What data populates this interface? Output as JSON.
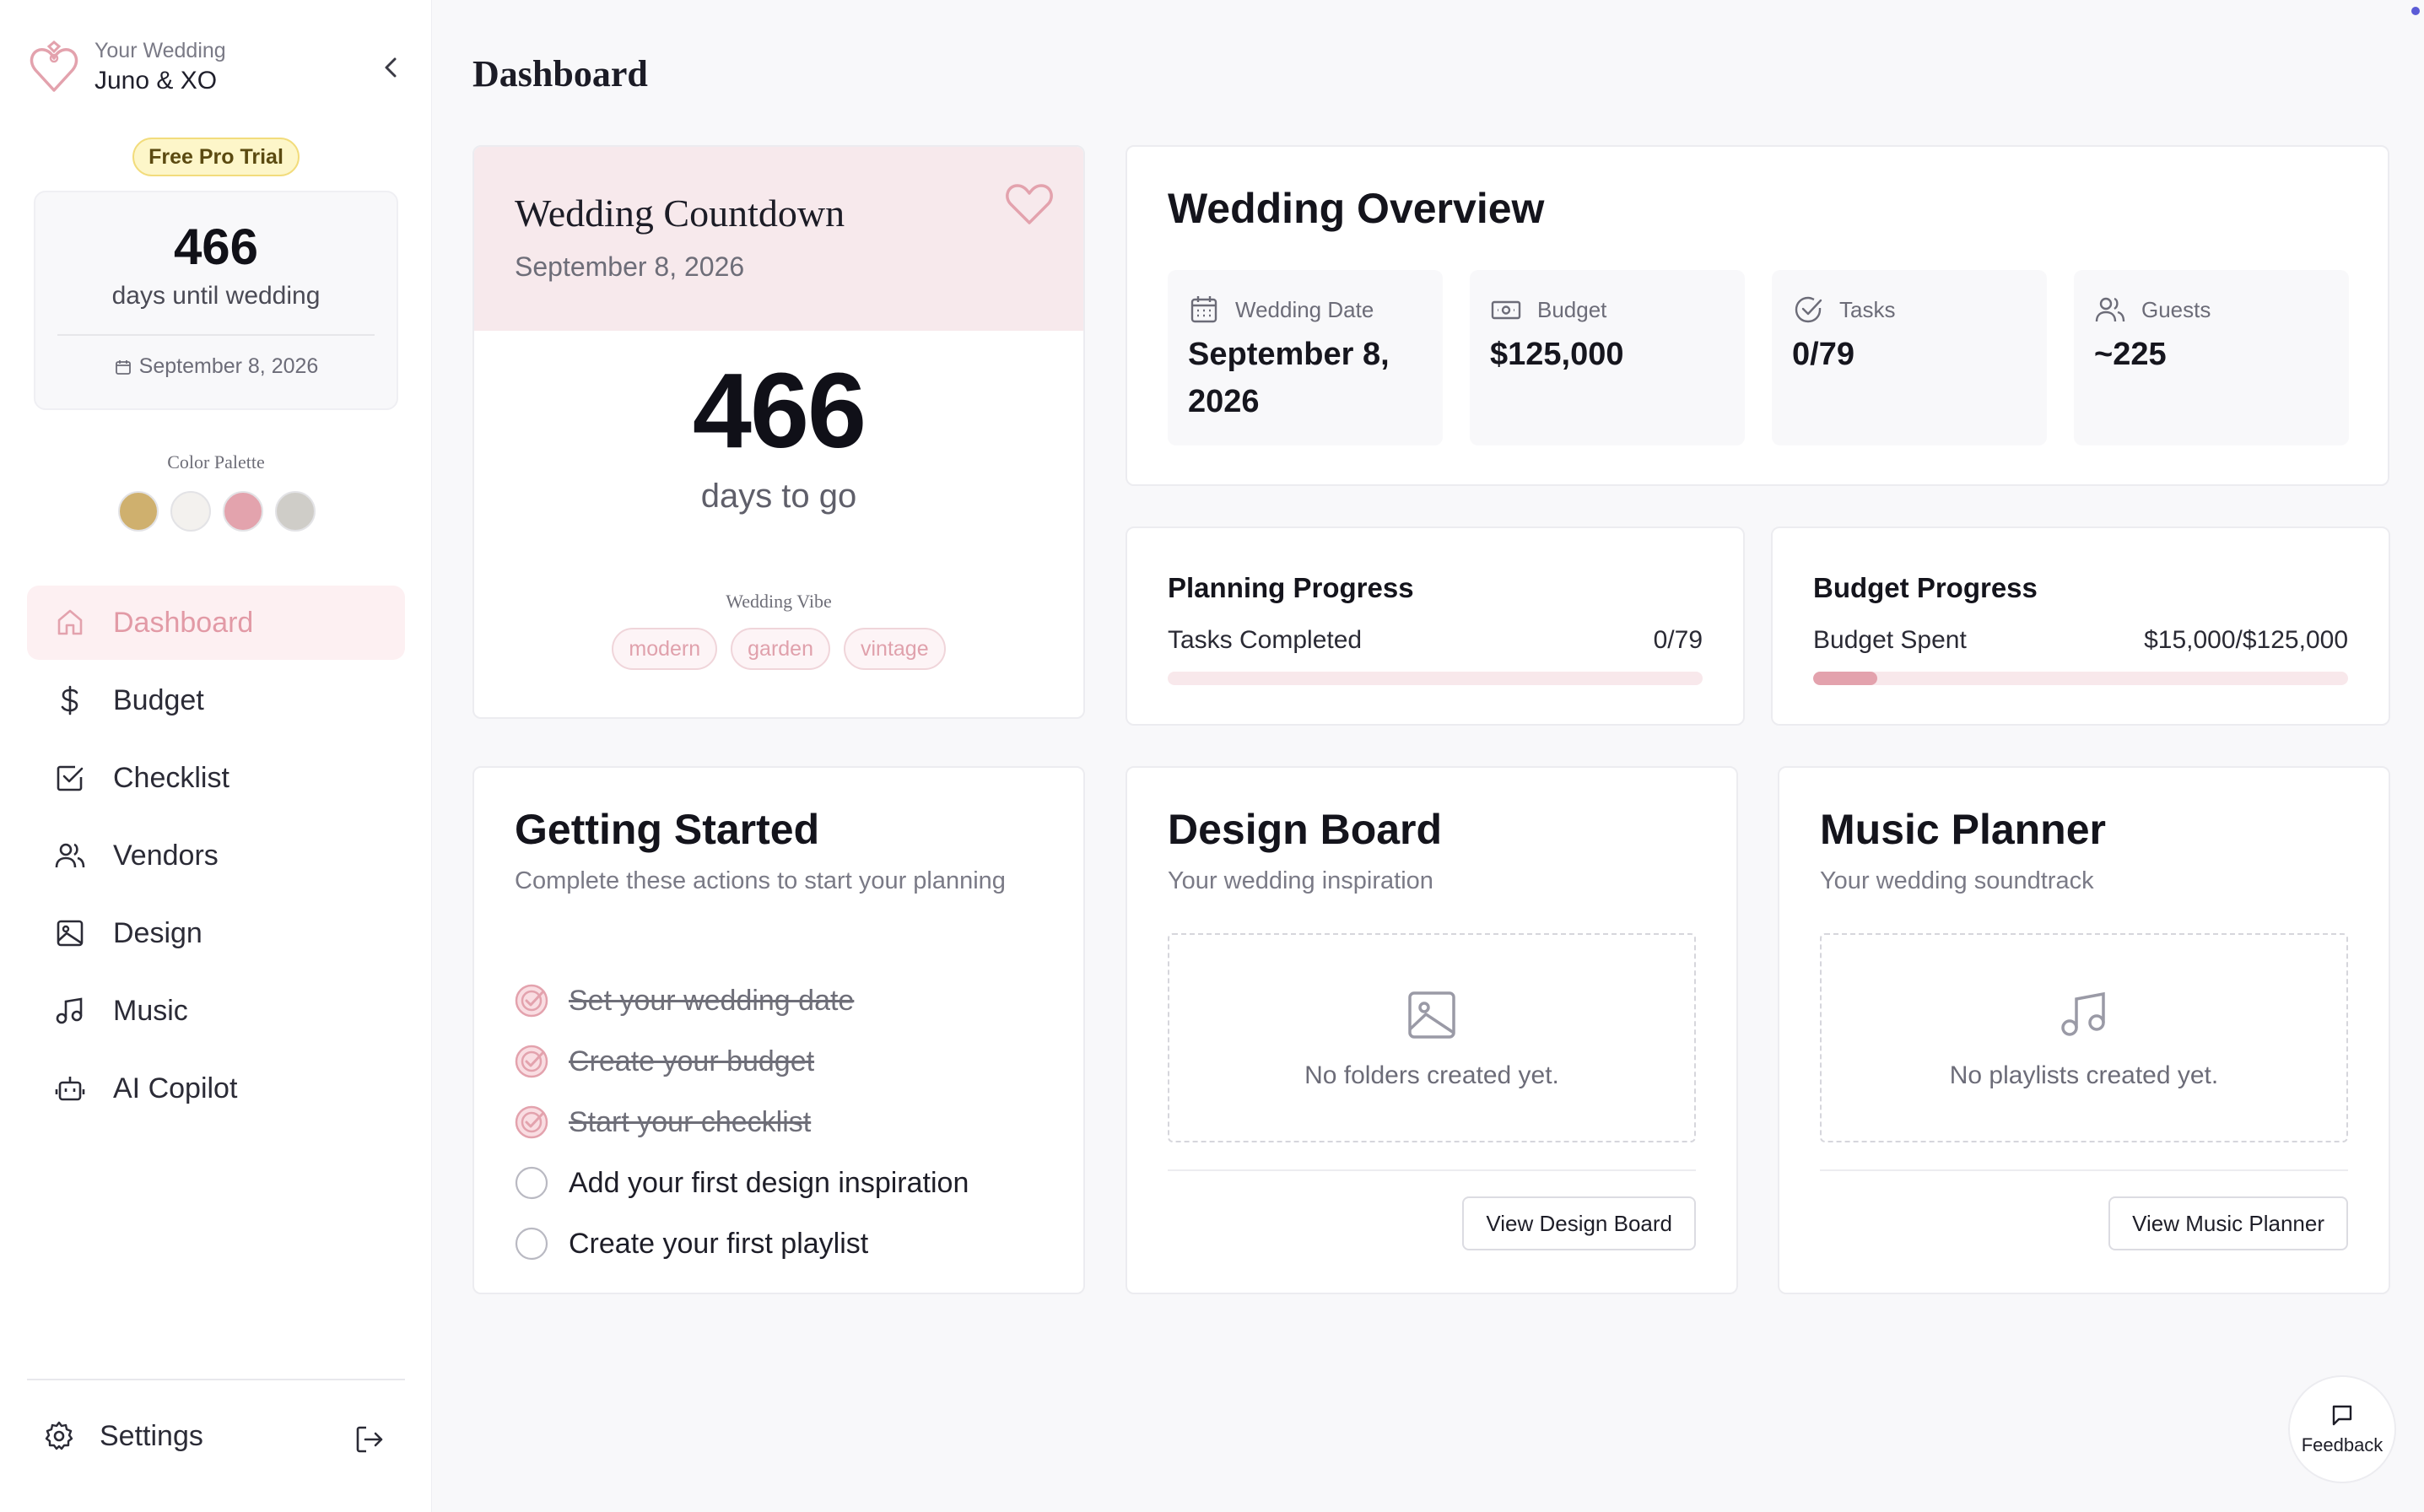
{
  "sidebar": {
    "brand_sub": "Your Wedding",
    "brand_name": "Juno & XO",
    "trial_badge": "Free Pro Trial",
    "countdown": {
      "days": "466",
      "label": "days until wedding",
      "date": "September 8, 2026"
    },
    "palette_title": "Color Palette",
    "palette_colors": [
      "#cfb06e",
      "#f3f1ee",
      "#e3a3ad",
      "#cfcdc8"
    ],
    "nav": [
      {
        "label": "Dashboard",
        "icon": "home-icon",
        "active": true
      },
      {
        "label": "Budget",
        "icon": "dollar-icon",
        "active": false
      },
      {
        "label": "Checklist",
        "icon": "checkbox-icon",
        "active": false
      },
      {
        "label": "Vendors",
        "icon": "users-icon",
        "active": false
      },
      {
        "label": "Design",
        "icon": "image-icon",
        "active": false
      },
      {
        "label": "Music",
        "icon": "music-icon",
        "active": false
      },
      {
        "label": "AI Copilot",
        "icon": "bot-icon",
        "active": false
      }
    ],
    "settings_label": "Settings"
  },
  "page_title": "Dashboard",
  "countdown_card": {
    "title": "Wedding Countdown",
    "date": "September 8, 2026",
    "days": "466",
    "days_label": "days to go",
    "vibe_label": "Wedding Vibe",
    "vibe_tags": [
      "modern",
      "garden",
      "vintage"
    ]
  },
  "overview": {
    "title": "Wedding Overview",
    "stats": [
      {
        "label": "Wedding Date",
        "value": "September 8, 2026",
        "icon": "calendar-icon"
      },
      {
        "label": "Budget",
        "value": "$125,000",
        "icon": "banknote-icon"
      },
      {
        "label": "Tasks",
        "value": "0/79",
        "icon": "check-circle-icon"
      },
      {
        "label": "Guests",
        "value": "~225",
        "icon": "users-icon"
      }
    ]
  },
  "planning_progress": {
    "title": "Planning Progress",
    "label": "Tasks Completed",
    "value": "0/79",
    "percent": 0
  },
  "budget_progress": {
    "title": "Budget Progress",
    "label": "Budget Spent",
    "value": "$15,000/$125,000",
    "percent": 12
  },
  "getting_started": {
    "title": "Getting Started",
    "subtitle": "Complete these actions to start your planning",
    "items": [
      {
        "label": "Set your wedding date",
        "done": true
      },
      {
        "label": "Create your budget",
        "done": true
      },
      {
        "label": "Start your checklist",
        "done": true
      },
      {
        "label": "Add your first design inspiration",
        "done": false
      },
      {
        "label": "Create your first playlist",
        "done": false
      }
    ]
  },
  "design_board": {
    "title": "Design Board",
    "subtitle": "Your wedding inspiration",
    "empty_text": "No folders created yet.",
    "button": "View Design Board"
  },
  "music_planner": {
    "title": "Music Planner",
    "subtitle": "Your wedding soundtrack",
    "empty_text": "No playlists created yet.",
    "button": "View Music Planner"
  },
  "feedback_label": "Feedback",
  "colors": {
    "accent": "#e3a2ad",
    "accent_bg": "#fdf0f2",
    "trial_bg": "#fdf6c9"
  }
}
